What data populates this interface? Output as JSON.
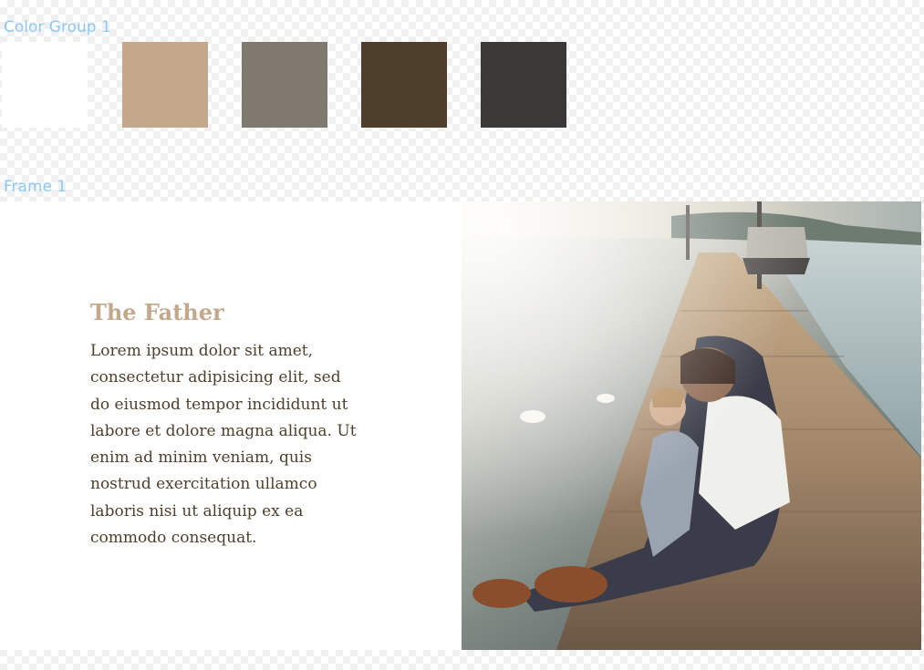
{
  "canvas": {
    "color_group_label": "Color Group 1",
    "frame_label": "Frame 1"
  },
  "color_group": {
    "swatches": [
      {
        "name": "white",
        "color": "#ffffff"
      },
      {
        "name": "tan",
        "color": "#c4a88c"
      },
      {
        "name": "taupe",
        "color": "#807970"
      },
      {
        "name": "dark-brown",
        "color": "#4e3f2c"
      },
      {
        "name": "charcoal",
        "color": "#3b3937"
      }
    ]
  },
  "frame": {
    "heading": "The Father",
    "body": "Lorem ipsum dolor sit amet, consectetur adipisicing elit, sed do eiusmod tempor incididunt ut labore et dolore magna aliqua. Ut enim ad minim veniam, quis nostrud exercitation ullamco laboris nisi ut aliquip ex ea commodo consequat.",
    "heading_color": "#c4a88c",
    "body_color": "#4e3f2c",
    "photo_icon": "father-daughter-on-dock-photo"
  }
}
